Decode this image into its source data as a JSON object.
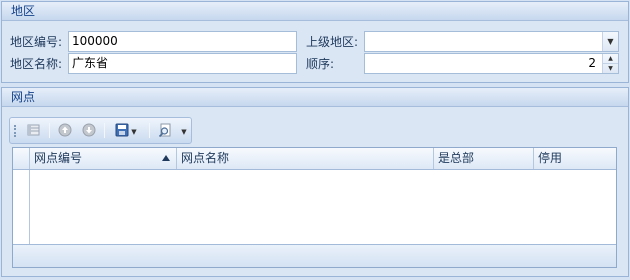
{
  "region": {
    "title": "地区",
    "code_label": "地区编号:",
    "code_value": "100000",
    "name_label": "地区名称:",
    "name_value": "广东省",
    "parent_label": "上级地区:",
    "parent_value": "",
    "order_label": "顺序:",
    "order_value": "2"
  },
  "branch": {
    "title": "网点",
    "toolbar": {
      "icons": [
        "grid-view-icon",
        "move-up-icon",
        "move-down-icon",
        "save-icon",
        "find-icon"
      ]
    },
    "grid": {
      "columns": [
        "网点编号",
        "网点名称",
        "是总部",
        "停用"
      ],
      "sorted_column": "网点编号",
      "sort_direction": "ascending",
      "rows": []
    }
  },
  "colors": {
    "background": "#d5e2f3",
    "header_text": "#15428b",
    "border": "#99b4d6"
  }
}
